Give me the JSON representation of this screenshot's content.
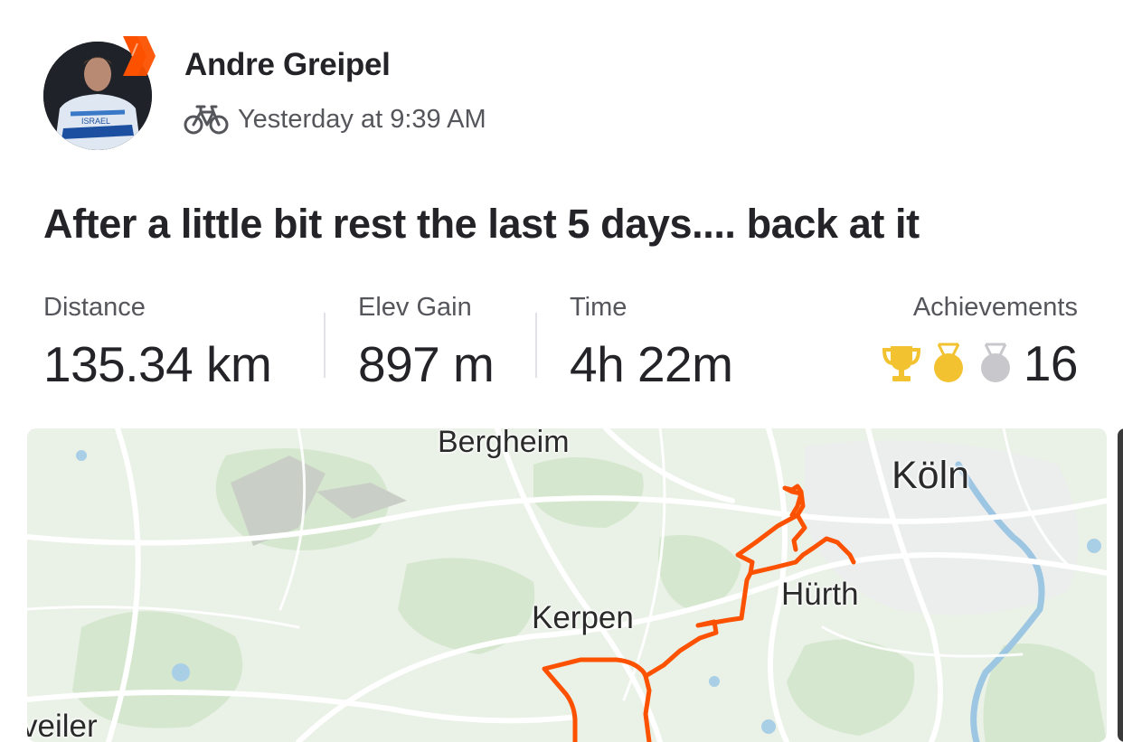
{
  "athlete": {
    "name": "Andre Greipel",
    "activity_icon": "bicycle-icon",
    "timestamp": "Yesterday at 9:39 AM",
    "badge_icon": "subscriber-chevron-icon"
  },
  "activity": {
    "title": "After a little bit rest the last 5 days.... back at it"
  },
  "stats": [
    {
      "label": "Distance",
      "value": "135.34 km"
    },
    {
      "label": "Elev Gain",
      "value": "897 m"
    },
    {
      "label": "Time",
      "value": "4h 22m"
    }
  ],
  "achievements": {
    "label": "Achievements",
    "icons": [
      "trophy-icon",
      "gold-medal-icon",
      "silver-medal-icon"
    ],
    "count": "16"
  },
  "map": {
    "places": [
      "Bergheim",
      "Köln",
      "Kerpen",
      "Hürth",
      "veiler"
    ],
    "route_color": "#fc5200"
  },
  "colors": {
    "brand": "#fc5200",
    "trophy": "#f2c230",
    "gold": "#f2c230",
    "silver": "#c8c8cc"
  }
}
